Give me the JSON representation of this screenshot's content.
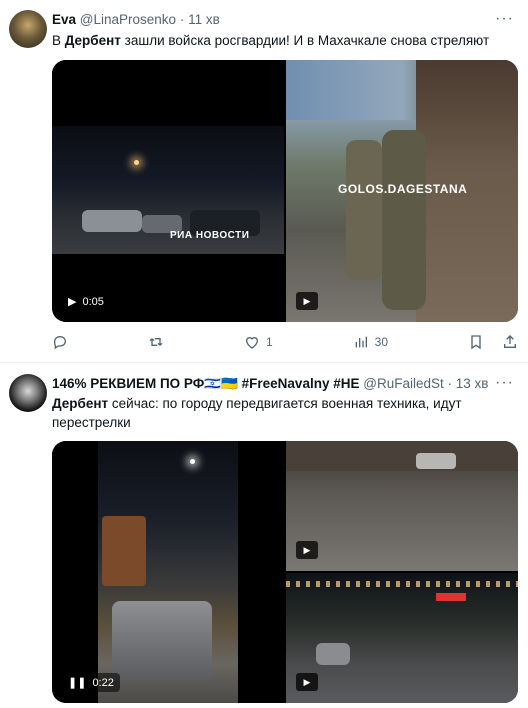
{
  "tweet1": {
    "author_name": "Eva",
    "handle": "@LinaProsenko",
    "time": "11 хв",
    "text_bold": "Дербент",
    "text_prefix": "В ",
    "text_rest": " зашли войска росгвардии! И в Махачкале снова стреляют",
    "video1": {
      "duration": "0:05",
      "watermark": "РИА НОВОСТИ"
    },
    "video2": {
      "watermark": "GOLOS.DAGESTANA"
    },
    "stats": {
      "likes": "1",
      "views": "30"
    }
  },
  "tweet2": {
    "author_name": "146% РЕКВИЕМ ПО РФ🇮🇱🇺🇦 #FreeNavalny #НЕ",
    "handle": "@RuFailedSt",
    "time": "13 хв",
    "text_bold": "Дербент",
    "text_rest": " сейчас: по городу передвигается военная техника, идут перестрелки",
    "video1": {
      "duration": "0:22"
    }
  },
  "icons": [
    "reply-icon",
    "retweet-icon",
    "like-icon",
    "views-icon",
    "bookmark-icon",
    "share-icon",
    "play-icon",
    "pause-icon",
    "more-icon"
  ],
  "colors": {
    "muted": "#536471",
    "divider": "#eff3f4"
  }
}
